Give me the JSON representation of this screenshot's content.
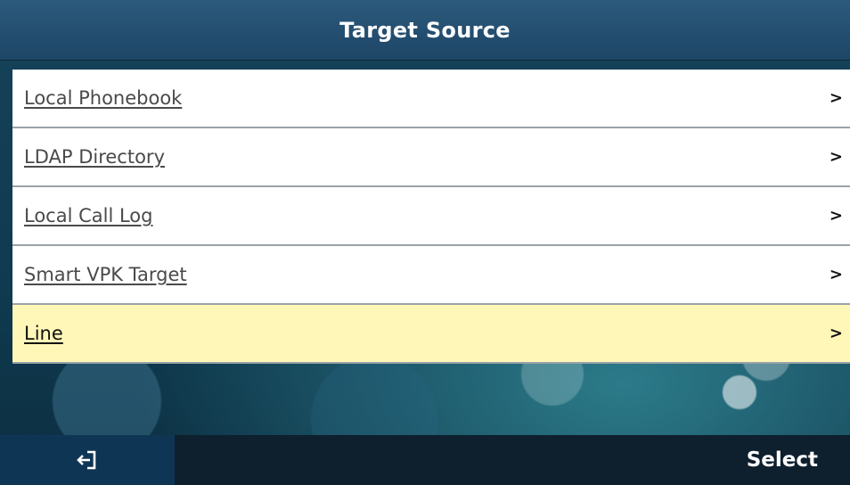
{
  "header": {
    "title": "Target Source"
  },
  "list": {
    "items": [
      {
        "label": "Local Phonebook",
        "selected": false
      },
      {
        "label": "LDAP Directory",
        "selected": false
      },
      {
        "label": "Local Call Log",
        "selected": false
      },
      {
        "label": "Smart VPK Target",
        "selected": false
      },
      {
        "label": "Line",
        "selected": true
      }
    ],
    "arrow": ">"
  },
  "softkeys": {
    "back_icon": "back-exit-icon",
    "select_label": "Select"
  },
  "colors": {
    "titlebar": "#2c5a7d",
    "selected_row": "#fff7b8",
    "softkey_bar": "#0e1f2e"
  }
}
